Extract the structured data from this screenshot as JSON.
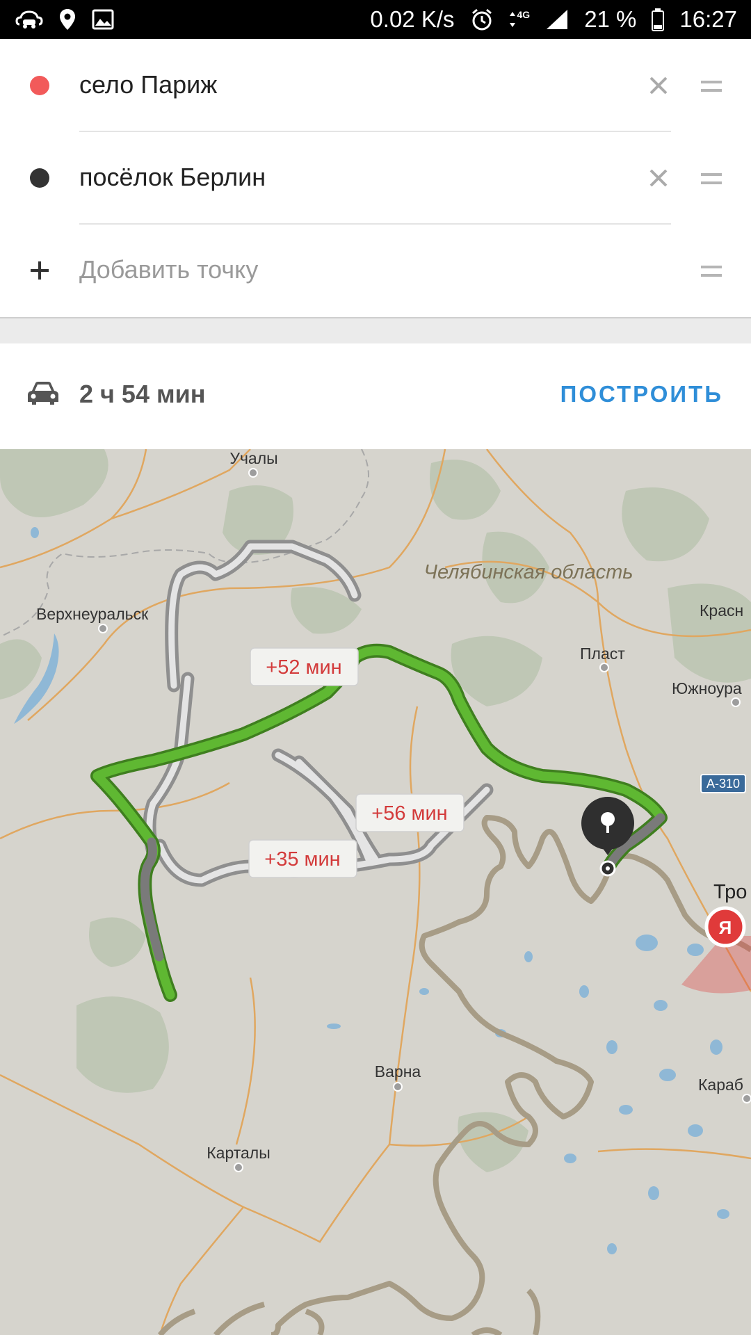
{
  "status_bar": {
    "speed": "0.02 K/s",
    "network": "4G",
    "battery": "21 %",
    "time": "16:27",
    "icons": [
      "cloud-car-icon",
      "location-pin-icon",
      "image-icon",
      "alarm-icon",
      "data-arrows-icon",
      "signal-icon",
      "battery-icon"
    ]
  },
  "route": {
    "from": {
      "value": "село Париж",
      "dot_color": "#f25a5a"
    },
    "to": {
      "value": "посёлок Берлин",
      "dot_color": "#333333"
    },
    "add_point_placeholder": "Добавить точку"
  },
  "summary": {
    "transport": "car-icon",
    "duration": "2 ч 54 мин",
    "build_label": "ПОСТРОИТЬ"
  },
  "map": {
    "region_label": "Челябинская область",
    "cities": [
      "Учалы",
      "Верхнеуральск",
      "Пласт",
      "Южноура",
      "Красн",
      "Тро",
      "Караб",
      "Варна",
      "Карталы"
    ],
    "road_sign": "А-310",
    "alt_routes": [
      "+52 мин",
      "+56 мин",
      "+35 мин"
    ],
    "user_marker_label": "Я",
    "colors": {
      "main_route": "#5fb832",
      "alt_route": "#9a9a9a",
      "map_bg": "#d6d4cd",
      "forest": "#bfc7b5",
      "water": "#8fb8d6",
      "border": "#a79c86",
      "alt_label": "#d33b3b"
    }
  }
}
